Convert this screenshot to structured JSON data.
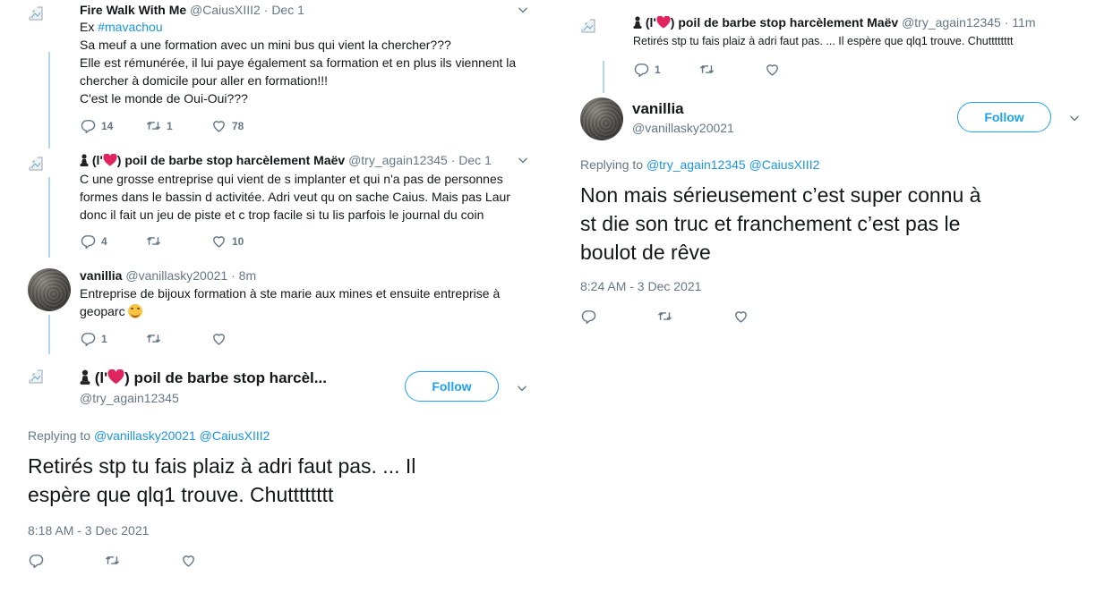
{
  "left": {
    "tweets": [
      {
        "name": "Fire Walk With Me",
        "handle": "@CaiusXIII2",
        "dot": "·",
        "time": "Dec 1",
        "lines": [
          "Ex ",
          "#mavachou",
          "Sa meuf a une formation avec un mini bus qui vient la chercher???",
          "Elle est rémunérée, il lui paye également sa formation et en plus ils viennent la",
          "chercher à domicile pour aller en formation!!!",
          "C'est le monde de Oui-Oui???"
        ],
        "replies": "14",
        "retweets": "1",
        "likes": "78"
      },
      {
        "name_prefix": "(l'",
        "name_suffix": ") poil de barbe stop harcèlement Maëv",
        "handle": "@try_again12345",
        "dot": "·",
        "time": "Dec 1",
        "lines": [
          "C une grosse entreprise  qui vient de s implanter et qui n'a pas de personnes",
          "formes dans le bassin d activitée.  Adri veut qu on sache  Caius. Mais pas Laur",
          "donc il fait un jeu de piste et   c trop facile  si tu lis parfois le journal  du coin"
        ],
        "replies": "4",
        "retweets": "",
        "likes": "10"
      },
      {
        "name": "vanillia",
        "handle": "@vanillasky20021",
        "dot": "·",
        "time": "8m",
        "lines": [
          "Entreprise de bijoux formation à ste marie aux mines et ensuite entreprise à",
          "geoparc"
        ],
        "replies": "1",
        "retweets": "",
        "likes": ""
      }
    ],
    "main": {
      "name_prefix": "(l'",
      "name_suffix": ") poil de barbe stop harcèl...",
      "handle": "@try_again12345",
      "follow_label": "Follow",
      "replying_label": "Replying to",
      "replying_to": [
        "@vanillasky20021",
        "@CaiusXIII2"
      ],
      "text_lines": [
        "Retirés stp  tu fais plaiz à adri faut pas.  ... Il",
        "espère que qlq1 trouve. Chutttttttt"
      ],
      "timestamp": "8:18 AM - 3 Dec 2021"
    }
  },
  "right": {
    "tweet": {
      "name_prefix": "(l'",
      "name_suffix": ") poil de barbe stop harcèlement Maëv",
      "handle": "@try_again12345",
      "dot": "·",
      "time": "11m",
      "text": "Retirés stp  tu fais plaiz à adri faut pas.  ... Il espère que qlq1 trouve. Chutttttttt",
      "replies": "1",
      "retweets": "",
      "likes": ""
    },
    "main": {
      "name": "vanillia",
      "handle": "@vanillasky20021",
      "follow_label": "Follow",
      "replying_label": "Replying to",
      "replying_to": [
        "@try_again12345",
        "@CaiusXIII2"
      ],
      "text_lines": [
        "Non mais sérieusement c’est super connu à",
        "st die son truc et franchement c’est pas le",
        "boulot de rêve"
      ],
      "timestamp": "8:24 AM - 3 Dec 2021"
    }
  },
  "colors": {
    "accent": "#1da1f2",
    "link": "#1b95e0",
    "muted": "#657786",
    "text": "#14171a",
    "thread": "#b0d6ef",
    "heart": "#e0245e"
  },
  "icons": [
    "chevron-down-icon",
    "reply-icon",
    "retweet-icon",
    "like-icon",
    "broken-image-icon",
    "pawn-icon",
    "heart-emoji-icon",
    "smile-emoji-icon"
  ]
}
